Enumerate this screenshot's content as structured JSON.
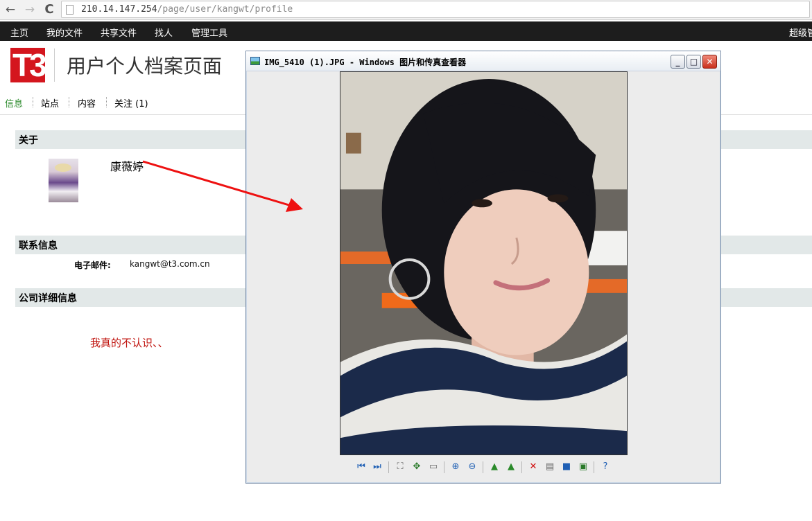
{
  "browser": {
    "url_host": "210.14.147.254",
    "url_path": "/page/user/kangwt/profile",
    "back_glyph": "←",
    "forward_glyph": "→",
    "reload_glyph": "C"
  },
  "top_nav": {
    "items": [
      "主页",
      "我的文件",
      "共享文件",
      "找人",
      "管理工具"
    ],
    "right_item": "超级管"
  },
  "header": {
    "logo_text": "T3",
    "title": "用户个人档案页面"
  },
  "sub_tabs": [
    "信息",
    "站点",
    "内容",
    "关注 (1)"
  ],
  "sections": {
    "about": "关于",
    "contact": "联系信息",
    "company": "公司详细信息"
  },
  "profile": {
    "name": "康薇婷",
    "email_label": "电子邮件:",
    "email": "kangwt@t3.com.cn",
    "company_note": "我真的不认识、、"
  },
  "viewer": {
    "title": "IMG_5410 (1).JPG - Windows 图片和传真查看器",
    "min_glyph": "_",
    "max_glyph": "□",
    "close_glyph": "✕",
    "toolbar_icons": [
      "previous-icon",
      "next-icon",
      "best-fit-icon",
      "actual-size-icon",
      "slideshow-icon",
      "zoom-in-icon",
      "zoom-out-icon",
      "rotate-clockwise-icon",
      "rotate-counterclockwise-icon",
      "delete-icon",
      "print-icon",
      "save-icon",
      "open-in-editor-icon",
      "help-icon"
    ]
  },
  "colors": {
    "nav_bg": "#1d1d1d",
    "logo_red": "#d4161e",
    "active_tab": "#2b8a2b",
    "section_bg": "#e2e8e8",
    "note_red": "#c0140f",
    "arrow_red": "#ee1111"
  }
}
